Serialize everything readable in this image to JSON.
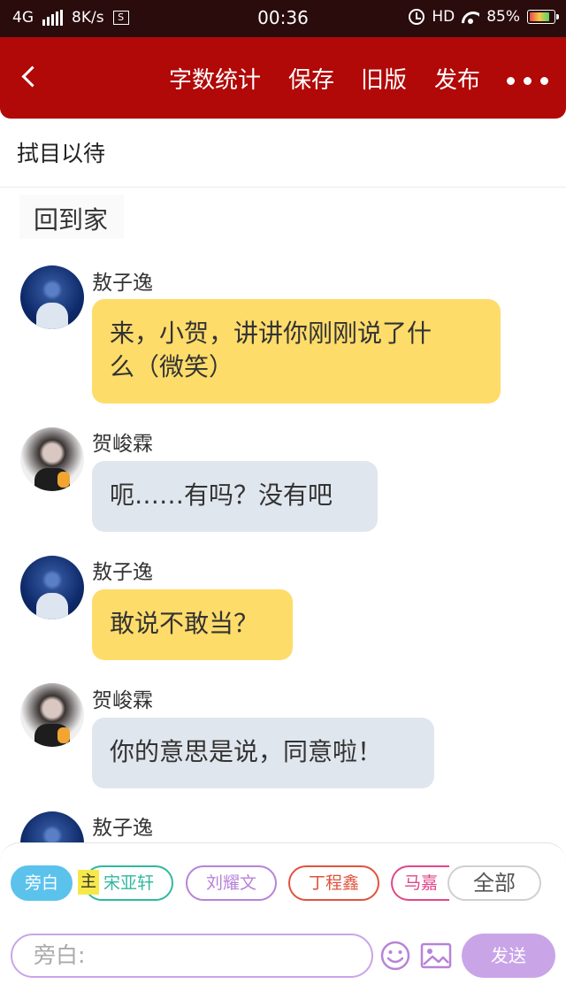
{
  "status_bar": {
    "network": "4G",
    "speed": "8K/s",
    "sim": "S",
    "time": "00:36",
    "hd": "HD",
    "battery": "85%"
  },
  "header": {
    "word_count": "字数统计",
    "save": "保存",
    "old_version": "旧版",
    "publish": "发布"
  },
  "story_title": "拭目以待",
  "scene_title": "回到家",
  "messages": [
    {
      "speaker": "敖子逸",
      "text_line1": "来，小贺，讲讲你刚刚说了什",
      "text_line2": "么（微笑）",
      "style": "yellow"
    },
    {
      "speaker": "贺峻霖",
      "text": "呃……有吗？没有吧",
      "style": "grey"
    },
    {
      "speaker": "敖子逸",
      "text": "敢说不敢当？",
      "style": "yellow"
    },
    {
      "speaker": "贺峻霖",
      "text": "你的意思是说，同意啦！",
      "style": "grey"
    },
    {
      "speaker": "敖子逸"
    }
  ],
  "characters": [
    {
      "label": "旁白",
      "color": "#5bc2ec",
      "active": true
    },
    {
      "label": "宋亚轩",
      "color": "#31b8a0"
    },
    {
      "label": "刘耀文",
      "color": "#b783d8"
    },
    {
      "label": "丁程鑫",
      "color": "#e0533d"
    },
    {
      "label": "马嘉",
      "color": "#e0478a"
    }
  ],
  "main_tag": "主",
  "all_label": "全部",
  "input_placeholder": "旁白:",
  "send_label": "发送",
  "accent_colors": {
    "header": "#b10808",
    "send": "#c9a5e8",
    "yellow_bubble": "#fedc6a",
    "grey_bubble": "#e0e6ed"
  }
}
